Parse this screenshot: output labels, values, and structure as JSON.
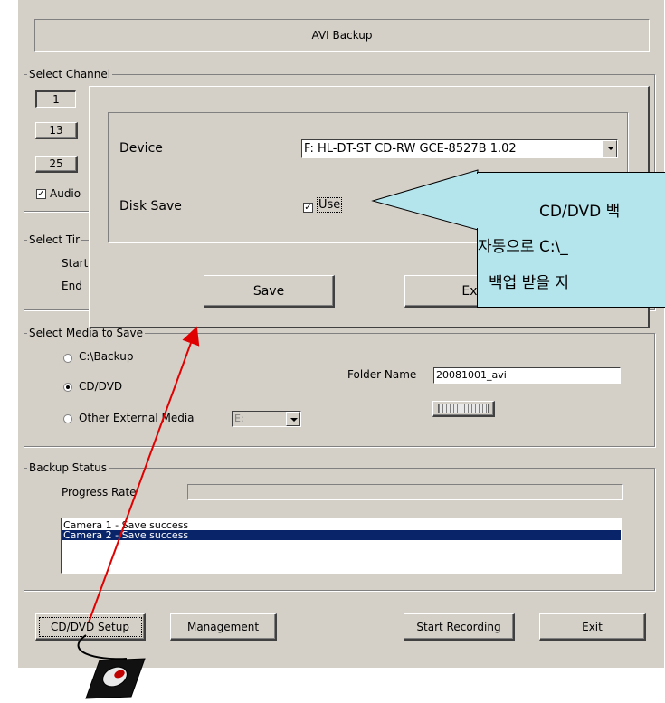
{
  "window": {
    "title": "AVI Backup"
  },
  "select_channel": {
    "title": "Select Channel",
    "channels": [
      "1",
      "13",
      "25"
    ],
    "audio_label": "Audio",
    "audio_checked": true
  },
  "select_time": {
    "title": "Select Tir",
    "start_label": "Start",
    "end_label": "End"
  },
  "select_media": {
    "title": "Select Media to Save",
    "options": [
      {
        "label": "C:\\Backup",
        "selected": false
      },
      {
        "label": "CD/DVD",
        "selected": true
      },
      {
        "label": "Other External Media",
        "selected": false
      }
    ],
    "external_drive": "E:",
    "folder_label": "Folder Name",
    "folder_value": "20081001_avi"
  },
  "backup_status": {
    "title": "Backup Status",
    "progress_label": "Progress Rate",
    "progress": 0,
    "log": [
      {
        "text": "Camera  1 - Save success",
        "selected": false
      },
      {
        "text": "Camera  2 - Save success",
        "selected": true
      }
    ]
  },
  "buttons": {
    "cd_dvd_setup": "CD/DVD Setup",
    "management": "Management",
    "start_recording": "Start Recording",
    "exit": "Exit"
  },
  "dialog": {
    "device_label": "Device",
    "device_value": "F: HL-DT-ST CD-RW GCE-8527B 1.02",
    "disk_save_label": "Disk Save",
    "use_label": "Use",
    "use_checked": true,
    "save_button": "Save",
    "exit_button": "Ex"
  },
  "callout": {
    "line1": "CD/DVD 백",
    "line2": "자동으로 C:\\_",
    "line3": "백업 받을 지"
  },
  "colors": {
    "face": "#d4d0c8",
    "selection": "#0a246a",
    "callout": "#b4e4ec",
    "arrow": "#e00000"
  }
}
